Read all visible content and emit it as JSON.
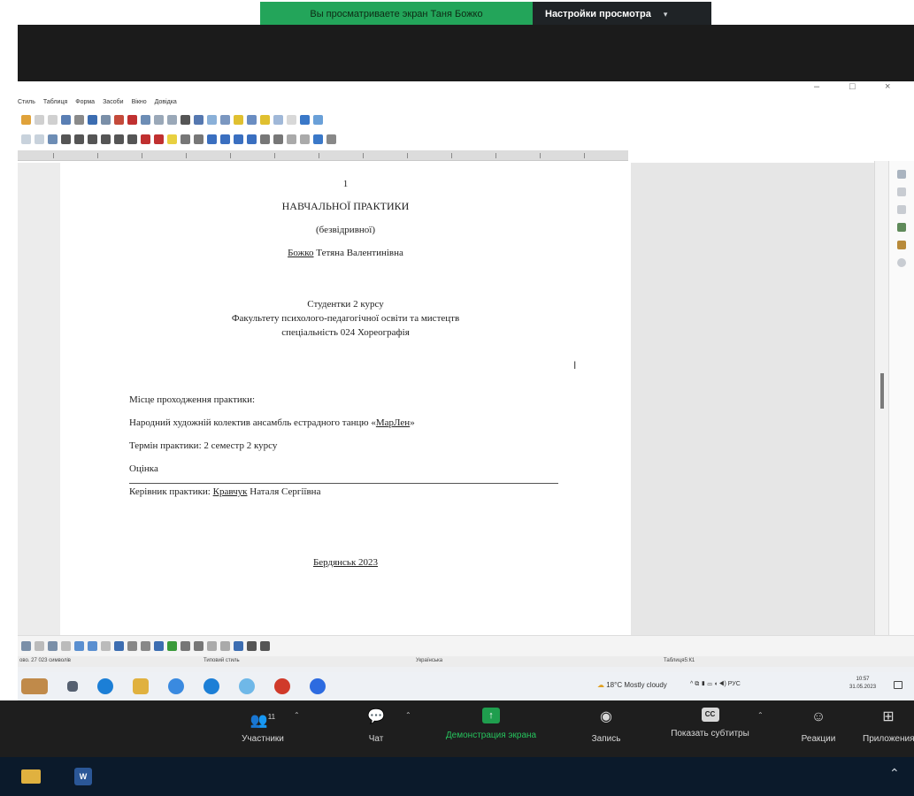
{
  "zoom_banner": {
    "sharing_text": "Вы просматриваете экран Таня Божко",
    "view_settings_label": "Настройки просмотра"
  },
  "app_window": {
    "menu": [
      "Стиль",
      "Таблиця",
      "Форма",
      "Засоби",
      "Вікно",
      "Довідка"
    ],
    "status": {
      "page": "ово. 27 023 символів",
      "style": "Типовий стиль",
      "language": "Українська",
      "table": "Таблиця5:К1"
    }
  },
  "document": {
    "page_number": "1",
    "title": "НАВЧАЛЬНОЇ ПРАКТИКИ",
    "subtitle": "(безвідривної)",
    "student_surname": "Божко",
    "student_rest": " Тетяна Валентинівна",
    "line_course": "Студентки 2 курсу",
    "line_faculty": "Факультету психолого-педагогічної освіти та мистецтв",
    "line_specialty": "спеціальність 024 Хореографія",
    "place_label": "Місце проходження практики:",
    "collective_prefix": "Народний художній колектив ансамбль естрадного танцю «",
    "collective_name": "МарЛен",
    "collective_suffix": "»",
    "term": "Термін практики: 2 семестр 2 курсу",
    "grade_label": "Оцінка",
    "supervisor_prefix": "Керівник практики: ",
    "supervisor_surname": "Кравчук",
    "supervisor_rest": " Наталя Сергіївна",
    "city_year": "Бердянськ 2023"
  },
  "win_taskbar": {
    "weather": "18°C  Mostly cloudy",
    "tray": "^  ⧉  ▮  ▭  ◖  ◀)  РУС",
    "time": "10:57",
    "date": "31.05.2023"
  },
  "zoom_controls": {
    "participants": "Участники",
    "participants_count": "11",
    "chat": "Чат",
    "share_screen": "Демонстрация экрана",
    "record": "Запись",
    "captions": "Показать субтитры",
    "reactions": "Реакции",
    "apps": "Приложения"
  },
  "colors": {
    "zoom_green": "#23a55a",
    "zoom_bar": "#1e1e1e",
    "host_taskbar": "#0b1a2b"
  }
}
